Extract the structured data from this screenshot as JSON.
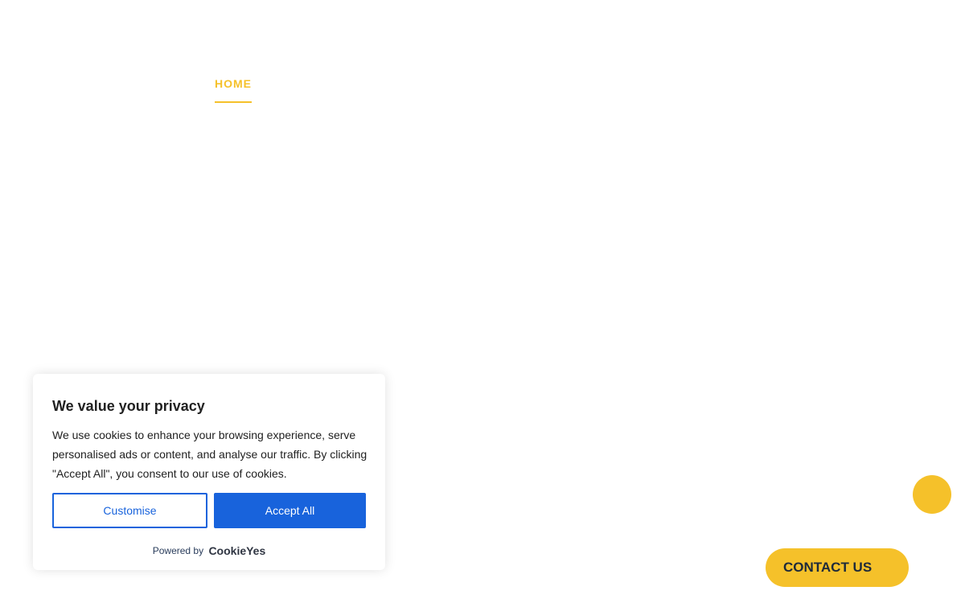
{
  "nav": {
    "home_label": "HOME"
  },
  "cookie_banner": {
    "title": "We value your privacy",
    "body": "We use cookies to enhance your browsing experience, serve personalised ads or content, and analyse our traffic. By clicking \"Accept All\", you consent to our use of cookies.",
    "customise_label": "Customise",
    "accept_label": "Accept All",
    "powered_by_label": "Powered by",
    "brand_name": "CookieYes"
  },
  "contact": {
    "label": "CONTACT US"
  },
  "colors": {
    "accent": "#f5c12a",
    "cookie_primary": "#1863dc",
    "text_dark": "#212121"
  }
}
